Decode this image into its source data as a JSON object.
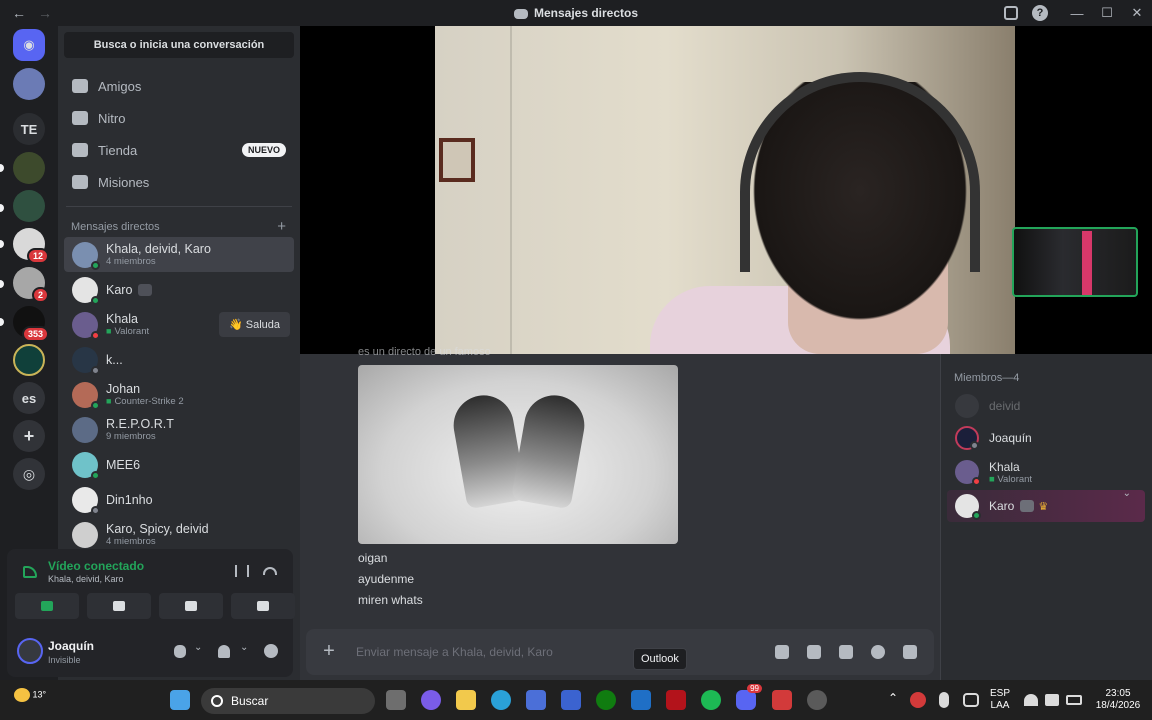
{
  "window": {
    "title": "Mensajes directos"
  },
  "guilds": [
    {
      "label": "TE"
    },
    {
      "label": "12"
    },
    {
      "label": "2"
    },
    {
      "label": "353"
    },
    {
      "label": "es"
    }
  ],
  "sidebar": {
    "search": "Busca o inicia una conversación",
    "nav": [
      {
        "label": "Amigos"
      },
      {
        "label": "Nitro"
      },
      {
        "label": "Tienda",
        "badge": "NUEVO"
      },
      {
        "label": "Misiones"
      }
    ],
    "dm_header": "Mensajes directos",
    "dms": [
      {
        "name": "Khala, deivid, Karo",
        "sub": "4 miembros"
      },
      {
        "name": "Karo"
      },
      {
        "name": "Khala",
        "sub": "Valorant",
        "action": "Saluda"
      },
      {
        "name": "k..."
      },
      {
        "name": "Johan",
        "sub": "Counter-Strike 2"
      },
      {
        "name": "R.E.P.O.R.T",
        "sub": "9 miembros"
      },
      {
        "name": "MEE6"
      },
      {
        "name": "Din1nho"
      },
      {
        "name": "Karo, Spicy, deivid",
        "sub": "4 miembros"
      }
    ]
  },
  "voice": {
    "status": "Vídeo conectado",
    "channel": "Khala, deivid, Karo"
  },
  "user": {
    "name": "Joaquín",
    "status": "Invisible"
  },
  "chat": {
    "cut_text": "es un directo de un famoso",
    "messages": [
      "oigan",
      "ayudenme",
      "miren whats"
    ],
    "placeholder": "Enviar mensaje a Khala, deivid, Karo"
  },
  "members": {
    "header": "Miembros—4",
    "list": [
      {
        "name": "deivid"
      },
      {
        "name": "Joaquín"
      },
      {
        "name": "Khala",
        "sub": "Valorant"
      },
      {
        "name": "Karo"
      }
    ]
  },
  "tooltip": "Outlook",
  "taskbar": {
    "weather": "13°",
    "search": "Buscar",
    "lang1": "ESP",
    "lang2": "LAA",
    "time": "23:05",
    "date": "18/4/2026",
    "discord_badge": "99"
  }
}
